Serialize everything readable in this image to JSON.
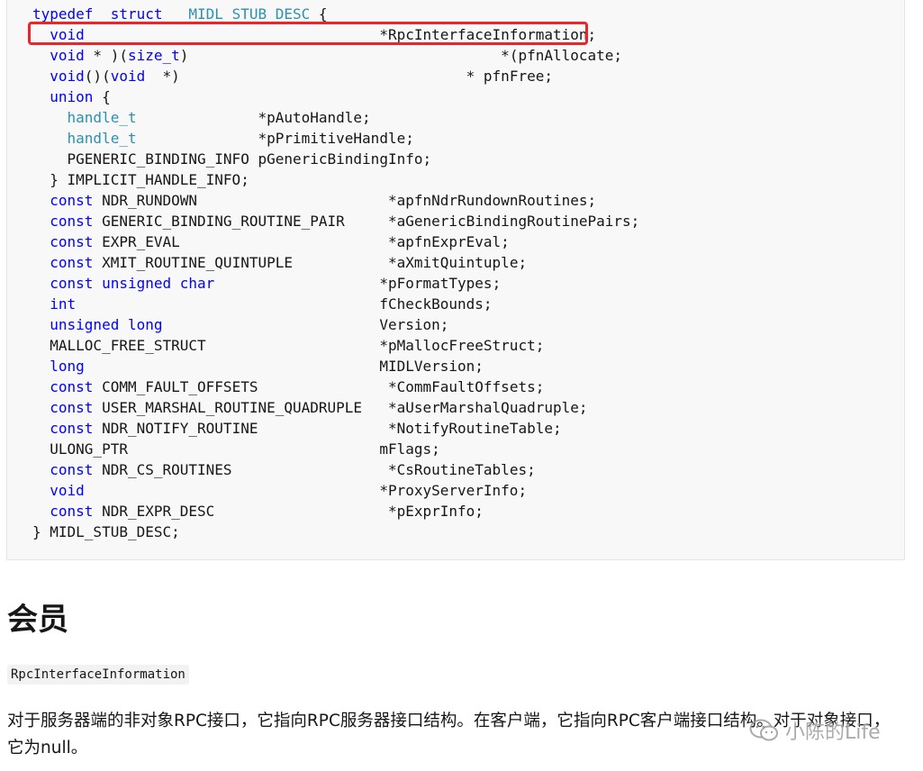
{
  "code": {
    "lines": [
      [
        [
          "kw",
          "typedef"
        ],
        [
          "",
          "  "
        ],
        [
          "kw",
          "struct"
        ],
        [
          "",
          "  "
        ],
        [
          "ty",
          "_MIDL_STUB_DESC"
        ],
        [
          "",
          " {"
        ]
      ],
      [
        [
          "",
          "  "
        ],
        [
          "kw",
          "void"
        ],
        [
          "",
          "                                  *RpcInterfaceInformation;"
        ]
      ],
      [
        [
          "",
          "  "
        ],
        [
          "kw",
          "void"
        ],
        [
          "",
          "",
          " * )("
        ],
        [
          "kw",
          "size_t"
        ],
        [
          "",
          ")                                    *(pfnAllocate;"
        ]
      ],
      [
        [
          "",
          "  "
        ],
        [
          "kw",
          "void"
        ],
        [
          "",
          "()("
        ],
        [
          "kw",
          "void"
        ],
        [
          "",
          "  *)                                 * pfnFree;"
        ]
      ],
      [
        [
          "",
          "  "
        ],
        [
          "kw",
          "union"
        ],
        [
          "",
          " {"
        ]
      ],
      [
        [
          "",
          "    "
        ],
        [
          "ty",
          "handle_t"
        ],
        [
          "",
          "              *pAutoHandle;"
        ]
      ],
      [
        [
          "",
          "    "
        ],
        [
          "ty",
          "handle_t"
        ],
        [
          "",
          "              *pPrimitiveHandle;"
        ]
      ],
      [
        [
          "",
          "    PGENERIC_BINDING_INFO pGenericBindingInfo;"
        ]
      ],
      [
        [
          "",
          "  } IMPLICIT_HANDLE_INFO;"
        ]
      ],
      [
        [
          "",
          "  "
        ],
        [
          "kw",
          "const"
        ],
        [
          "",
          " NDR_RUNDOWN                      *apfnNdrRundownRoutines;"
        ]
      ],
      [
        [
          "",
          "  "
        ],
        [
          "kw",
          "const"
        ],
        [
          "",
          " GENERIC_BINDING_ROUTINE_PAIR     *aGenericBindingRoutinePairs;"
        ]
      ],
      [
        [
          "",
          "  "
        ],
        [
          "kw",
          "const"
        ],
        [
          "",
          " EXPR_EVAL                        *apfnExprEval;"
        ]
      ],
      [
        [
          "",
          "  "
        ],
        [
          "kw",
          "const"
        ],
        [
          "",
          " XMIT_ROUTINE_QUINTUPLE           *aXmitQuintuple;"
        ]
      ],
      [
        [
          "",
          "  "
        ],
        [
          "kw",
          "const"
        ],
        [
          "kw",
          " unsigned"
        ],
        [
          "kw",
          " char"
        ],
        [
          "",
          "                   *pFormatTypes;"
        ]
      ],
      [
        [
          "",
          "  "
        ],
        [
          "kw",
          "int"
        ],
        [
          "",
          "                                   fCheckBounds;"
        ]
      ],
      [
        [
          "",
          "  "
        ],
        [
          "kw",
          "unsigned"
        ],
        [
          "kw",
          " long"
        ],
        [
          "",
          "                         Version;"
        ]
      ],
      [
        [
          "",
          "  MALLOC_FREE_STRUCT                    *pMallocFreeStruct;"
        ]
      ],
      [
        [
          "",
          "  "
        ],
        [
          "kw",
          "long"
        ],
        [
          "",
          "                                  MIDLVersion;"
        ]
      ],
      [
        [
          "",
          "  "
        ],
        [
          "kw",
          "const"
        ],
        [
          "",
          " COMM_FAULT_OFFSETS               *CommFaultOffsets;"
        ]
      ],
      [
        [
          "",
          "  "
        ],
        [
          "kw",
          "const"
        ],
        [
          "",
          " USER_MARSHAL_ROUTINE_QUADRUPLE   *aUserMarshalQuadruple;"
        ]
      ],
      [
        [
          "",
          "  "
        ],
        [
          "kw",
          "const"
        ],
        [
          "",
          " NDR_NOTIFY_ROUTINE               *NotifyRoutineTable;"
        ]
      ],
      [
        [
          "",
          "  ULONG_PTR                             mFlags;"
        ]
      ],
      [
        [
          "",
          "  "
        ],
        [
          "kw",
          "const"
        ],
        [
          "",
          " NDR_CS_ROUTINES                  *CsRoutineTables;"
        ]
      ],
      [
        [
          "",
          "  "
        ],
        [
          "kw",
          "void"
        ],
        [
          "",
          "                                  *ProxyServerInfo;"
        ]
      ],
      [
        [
          "",
          "  "
        ],
        [
          "kw",
          "const"
        ],
        [
          "",
          " NDR_EXPR_DESC                    *pExprInfo;"
        ]
      ],
      [
        [
          "",
          "} MIDL_STUB_DESC;"
        ]
      ]
    ],
    "highlight_line_index": 1,
    "colors": {
      "keyword": "#0101fd",
      "type": "#2b91af",
      "highlight_border": "#e8262c"
    }
  },
  "heading": "会员",
  "member_name": "RpcInterfaceInformation",
  "description": "对于服务器端的非对象RPC接口，它指向RPC服务器接口结构。在客户端，它指向RPC客户端接口结构。对于对象接口，它为null。",
  "watermark": {
    "icon": "wechat-logo-icon",
    "text": "小陈的Life"
  }
}
